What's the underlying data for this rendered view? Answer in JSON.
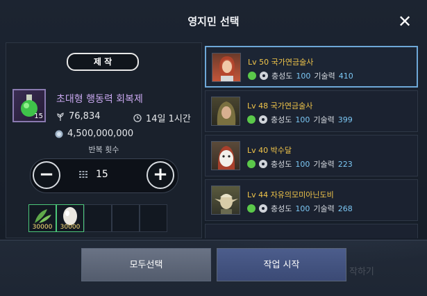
{
  "background": {
    "ghost_craft": "제작",
    "ghost_start": "작하기"
  },
  "dialog": {
    "title": "영지민 선택",
    "close_icon": "close-icon"
  },
  "craft": {
    "tab_label": "제 작",
    "item_name": "초대형 행동력 회복제",
    "item_count": "15",
    "energy_value": "76,834",
    "time_value": "14일 1시간",
    "silver_value": "4,500,000,000",
    "repeat_label": "반복 횟수",
    "quantity": "15",
    "materials": [
      {
        "name": "herb",
        "amount": "30000"
      },
      {
        "name": "egg",
        "amount": "30000"
      }
    ]
  },
  "workers": [
    {
      "level": "Lv 50",
      "name": "국가연금술사",
      "loyalty_label": "충성도",
      "loyalty": "100",
      "skill_label": "기술력",
      "skill": "410",
      "selected": true
    },
    {
      "level": "Lv 48",
      "name": "국가연금술사",
      "loyalty_label": "충성도",
      "loyalty": "100",
      "skill_label": "기술력",
      "skill": "399",
      "selected": false
    },
    {
      "level": "Lv 40",
      "name": "박수달",
      "loyalty_label": "충성도",
      "loyalty": "100",
      "skill_label": "기술력",
      "skill": "223",
      "selected": false
    },
    {
      "level": "Lv 44",
      "name": "자유의모미아닌도비",
      "loyalty_label": "충성도",
      "loyalty": "100",
      "skill_label": "기술력",
      "skill": "268",
      "selected": false
    }
  ],
  "buttons": {
    "select_all": "모두선택",
    "start_work": "작업 시작"
  },
  "colors": {
    "accent_name": "#f2c64a",
    "stat_value": "#7cc8f5",
    "selected_border": "#6ea8d8",
    "item_name": "#c9a8f0"
  }
}
